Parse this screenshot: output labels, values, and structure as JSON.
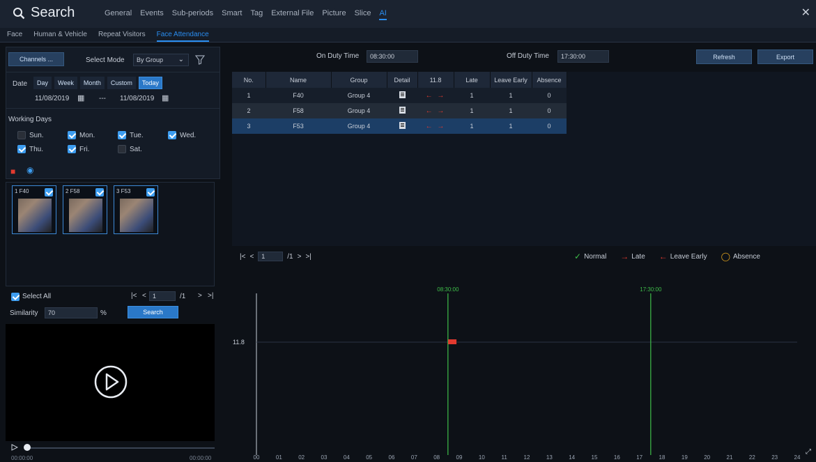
{
  "header": {
    "title": "Search",
    "tabs": [
      {
        "label": "General",
        "active": false
      },
      {
        "label": "Events",
        "active": false
      },
      {
        "label": "Sub-periods",
        "active": false
      },
      {
        "label": "Smart",
        "active": false
      },
      {
        "label": "Tag",
        "active": false
      },
      {
        "label": "External File",
        "active": false
      },
      {
        "label": "Picture",
        "active": false
      },
      {
        "label": "Slice",
        "active": false
      },
      {
        "label": "AI",
        "active": true
      }
    ],
    "close_icon": "close-icon"
  },
  "subtabs": [
    {
      "label": "Face",
      "active": false
    },
    {
      "label": "Human & Vehicle",
      "active": false
    },
    {
      "label": "Repeat Visitors",
      "active": false
    },
    {
      "label": "Face Attendance",
      "active": true
    }
  ],
  "left": {
    "channels_label": "Channels ...",
    "select_mode_label": "Select Mode",
    "select_mode_value": "By Group",
    "date_label": "Date",
    "date_tabs": [
      {
        "label": "Day",
        "active": false
      },
      {
        "label": "Week",
        "active": false
      },
      {
        "label": "Month",
        "active": false
      },
      {
        "label": "Custom",
        "active": false
      },
      {
        "label": "Today",
        "active": true
      }
    ],
    "start_date": "11/08/2019",
    "date_separator": "---",
    "end_date": "11/08/2019",
    "working_days_label": "Working Days",
    "days": [
      {
        "label": "Sun.",
        "checked": false
      },
      {
        "label": "Mon.",
        "checked": true
      },
      {
        "label": "Tue.",
        "checked": true
      },
      {
        "label": "Wed.",
        "checked": true
      },
      {
        "label": "Thu.",
        "checked": true
      },
      {
        "label": "Fri.",
        "checked": true
      },
      {
        "label": "Sat.",
        "checked": false
      }
    ],
    "faces": [
      {
        "label": "1 F40",
        "checked": true
      },
      {
        "label": "2 F58",
        "checked": true
      },
      {
        "label": "3 F53",
        "checked": true
      }
    ],
    "select_all_label": "Select All",
    "face_page": "1",
    "face_pages_total": "/1",
    "similarity_label": "Similarity",
    "similarity_value": "70",
    "percent": "%",
    "search_label": "Search",
    "time_start": "00:00:00",
    "time_end": "00:00:00"
  },
  "right": {
    "on_duty_label": "On Duty Time",
    "on_duty_value": "08:30:00",
    "off_duty_label": "Off Duty Time",
    "off_duty_value": "17:30:00",
    "refresh_label": "Refresh",
    "export_label": "Export",
    "columns": [
      "No.",
      "Name",
      "Group",
      "Detail",
      "11.8",
      "Late",
      "Leave Early",
      "Absence"
    ],
    "rows": [
      {
        "no": "1",
        "name": "F40",
        "group": "Group 4",
        "late": "1",
        "leave_early": "1",
        "absence": "0"
      },
      {
        "no": "2",
        "name": "F58",
        "group": "Group 4",
        "late": "1",
        "leave_early": "1",
        "absence": "0"
      },
      {
        "no": "3",
        "name": "F53",
        "group": "Group 4",
        "late": "1",
        "leave_early": "1",
        "absence": "0"
      }
    ],
    "page": "1",
    "pages_total": "/1",
    "legend": [
      {
        "label": "Normal",
        "color": "#3fbf4a"
      },
      {
        "label": "Late",
        "color": "#e23a2f"
      },
      {
        "label": "Leave Early",
        "color": "#e23a2f"
      },
      {
        "label": "Absence",
        "color": "#e0a21c"
      }
    ]
  },
  "chart_data": {
    "type": "timeline",
    "y_category": "11.8",
    "x_ticks": [
      "00",
      "01",
      "02",
      "03",
      "04",
      "05",
      "06",
      "07",
      "08",
      "09",
      "10",
      "11",
      "12",
      "13",
      "14",
      "15",
      "16",
      "17",
      "18",
      "19",
      "20",
      "21",
      "22",
      "23",
      "24"
    ],
    "xlim": [
      0,
      24
    ],
    "on_duty_marker": {
      "label": "08:30:00",
      "hour": 8.5,
      "color": "#3fbf4a"
    },
    "off_duty_marker": {
      "label": "17:30:00",
      "hour": 17.5,
      "color": "#3fbf4a"
    },
    "events": [
      {
        "hour": 8.6,
        "type": "late",
        "color": "#e23a2f"
      }
    ]
  }
}
